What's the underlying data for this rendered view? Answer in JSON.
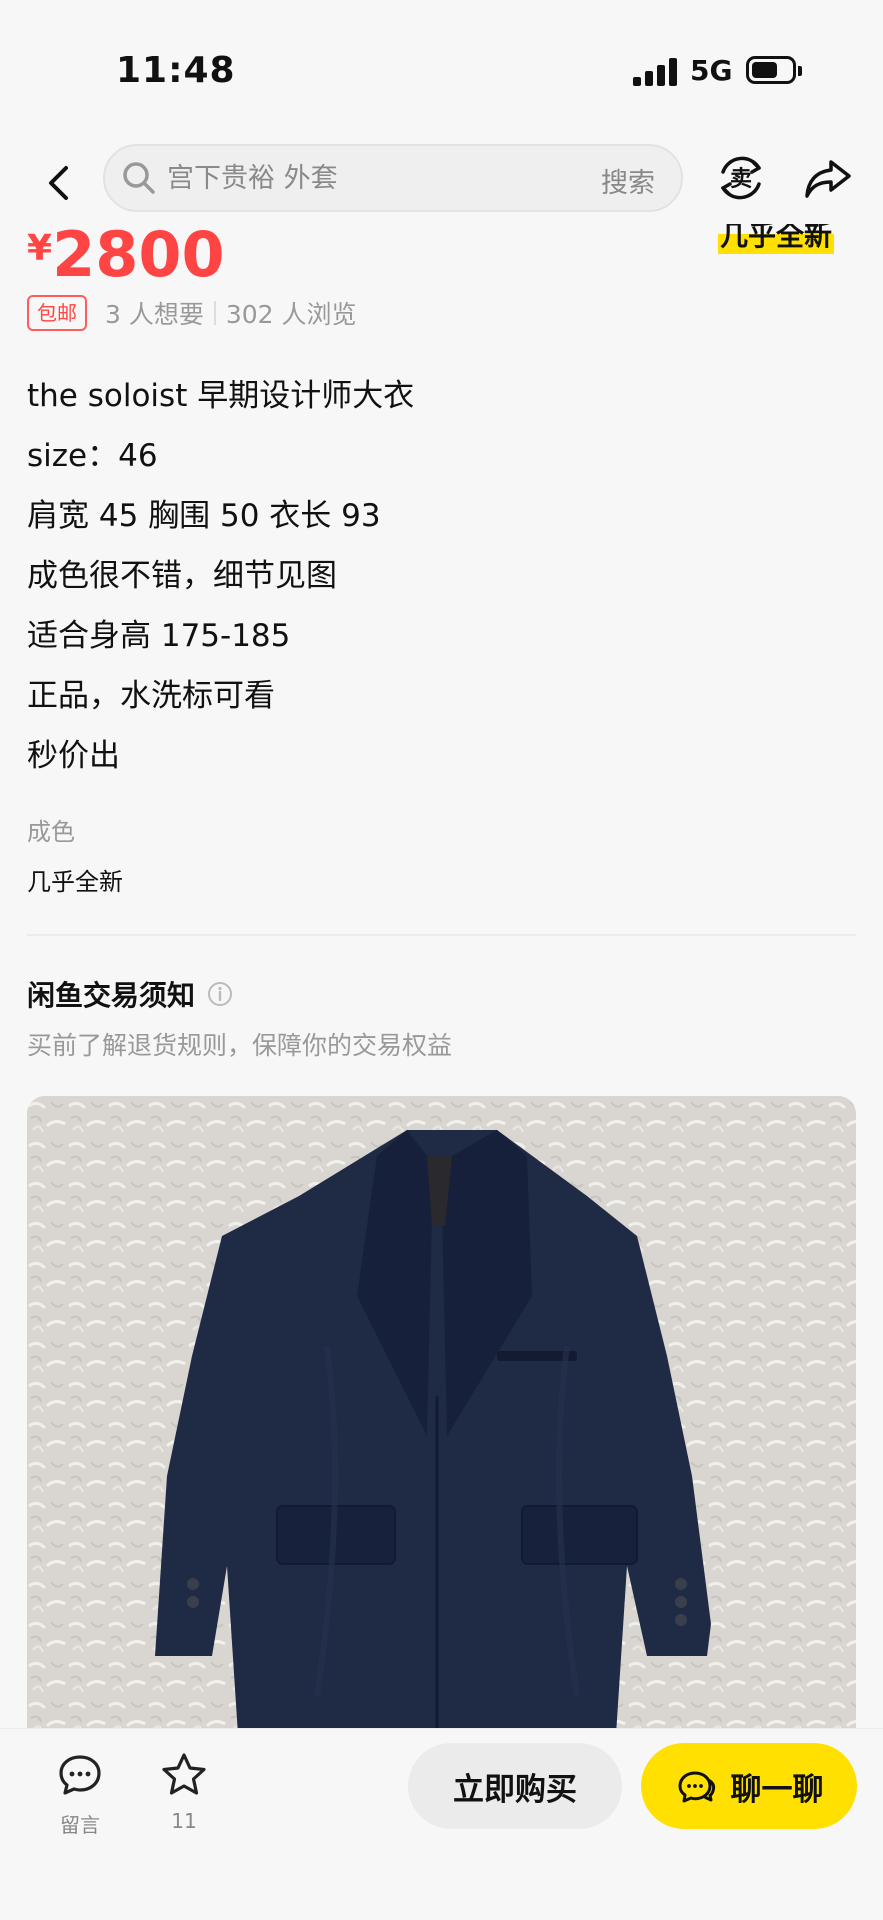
{
  "status_bar": {
    "time": "11:48",
    "network": "5G",
    "icons": [
      "signal-icon",
      "battery-icon"
    ]
  },
  "nav": {
    "search_placeholder": "宫下贵裕 外套",
    "search_button": "搜索",
    "icons": [
      "back-icon",
      "search-icon",
      "sell-icon",
      "share-icon"
    ],
    "sell_char": "卖"
  },
  "product": {
    "currency": "¥",
    "price": "2800",
    "condition_tag": "几乎全新",
    "free_shipping": "包邮",
    "wants": "3 人想要",
    "views": "302 人浏览",
    "description": [
      "the soloist 早期设计师大衣",
      "size：46",
      "肩宽 45 胸围 50 衣长 93",
      "成色很不错，细节见图",
      "适合身高 175-185",
      "正品，水洗标可看",
      "秒价出"
    ],
    "condition_label": "成色",
    "condition_value": "几乎全新"
  },
  "notice": {
    "title": "闲鱼交易须知",
    "subtitle": "买前了解退货规则，保障你的交易权益"
  },
  "bottom_bar": {
    "comment_label": "留言",
    "favorite_count": "11",
    "buy_label": "立即购买",
    "chat_label": "聊一聊"
  },
  "colors": {
    "price": "#ff4444",
    "accent_yellow": "#ffe000",
    "background": "#f7f7f7",
    "coat": "#1f2a45"
  }
}
